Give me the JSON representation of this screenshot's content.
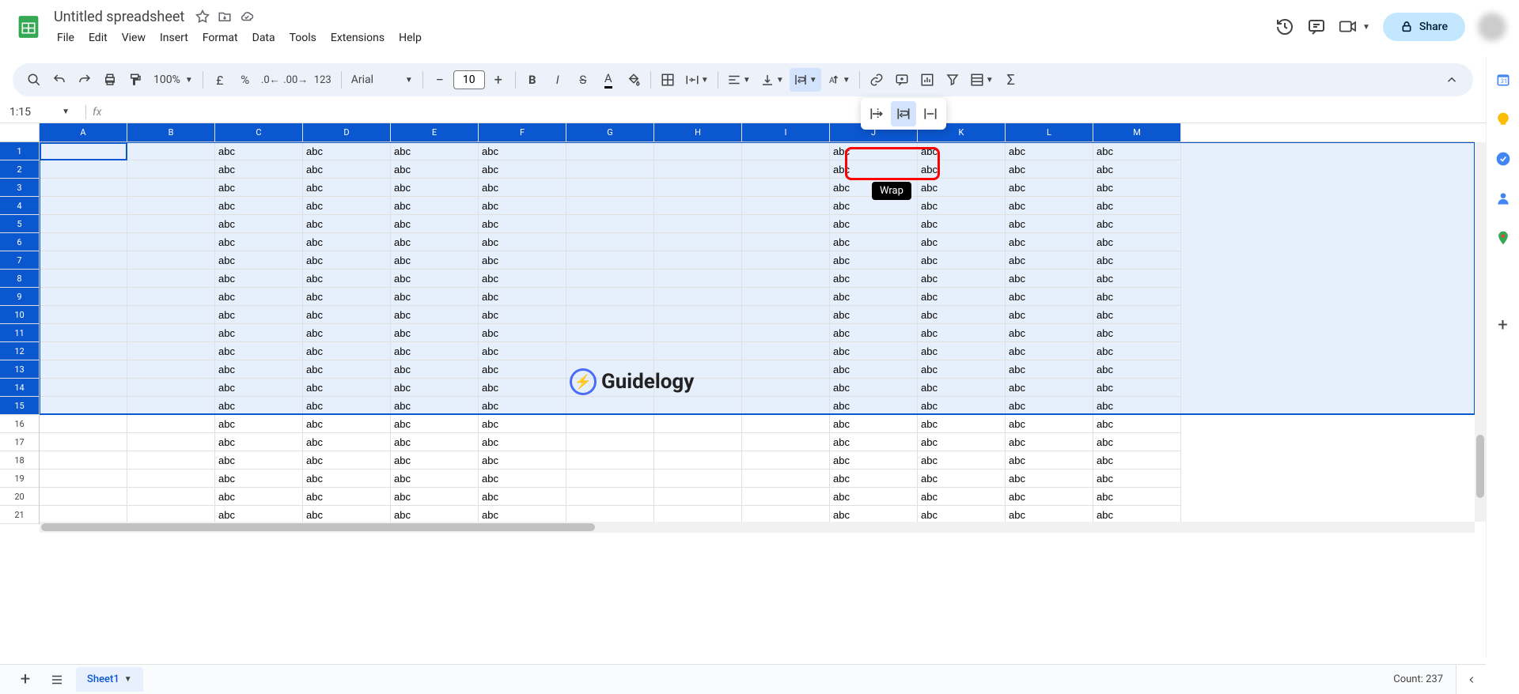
{
  "doc_title": "Untitled spreadsheet",
  "menus": [
    "File",
    "Edit",
    "View",
    "Insert",
    "Format",
    "Data",
    "Tools",
    "Extensions",
    "Help"
  ],
  "share_label": "Share",
  "zoom": "100%",
  "font_name": "Arial",
  "font_size": "10",
  "number_format_123": "123",
  "name_box": "1:15",
  "fx_label": "fx",
  "wrap_tooltip": "Wrap",
  "columns": [
    "A",
    "B",
    "C",
    "D",
    "E",
    "F",
    "G",
    "H",
    "I",
    "J",
    "K",
    "L",
    "M"
  ],
  "rows": [
    "1",
    "2",
    "3",
    "4",
    "5",
    "6",
    "7",
    "8",
    "9",
    "10",
    "11",
    "12",
    "13",
    "14",
    "15",
    "16",
    "17",
    "18",
    "19",
    "20",
    "21"
  ],
  "selected_rows": 15,
  "cell_value": "abc",
  "abc_cols": [
    2,
    3,
    4,
    5,
    9,
    10,
    11,
    12
  ],
  "sheet_name": "Sheet1",
  "count_text": "Count: 237",
  "watermark_text": "Guidelogy"
}
